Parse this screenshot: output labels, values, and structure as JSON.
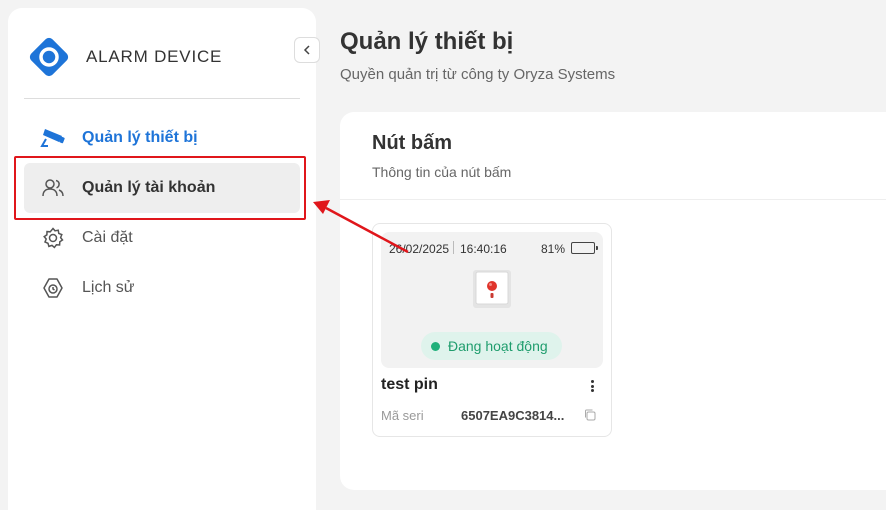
{
  "brand": {
    "name": "ALARM DEVICE"
  },
  "sidebar": {
    "items": [
      {
        "label": "Quản lý thiết bị"
      },
      {
        "label": "Quản lý tài khoản"
      },
      {
        "label": "Cài đặt"
      },
      {
        "label": "Lịch sử"
      }
    ]
  },
  "header": {
    "title": "Quản lý thiết bị",
    "subtitle": "Quyền quản trị từ công ty Oryza Systems"
  },
  "section": {
    "title": "Nút bấm",
    "subtitle": "Thông tin của nút bấm"
  },
  "device": {
    "date": "26/02/2025",
    "time": "16:40:16",
    "battery": "81%",
    "battery_level": 0.81,
    "status": "Đang hoạt động",
    "name": "test pin",
    "serial_label": "Mã seri",
    "serial_value": "6507EA9C3814..."
  },
  "colors": {
    "accent": "#1e74d8",
    "highlight": "#e0161b",
    "status_green": "#1fb07a",
    "battery_green": "#29b34a"
  }
}
